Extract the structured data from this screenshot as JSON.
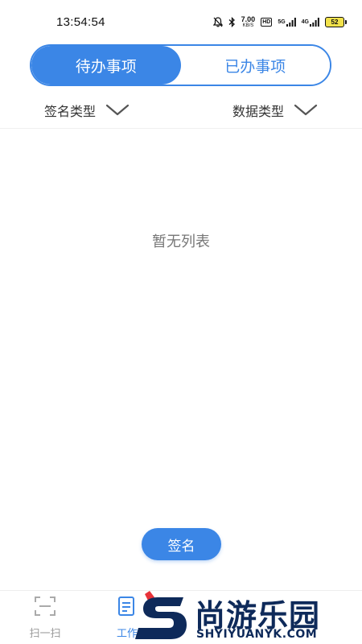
{
  "status_bar": {
    "time": "13:54:54",
    "net_speed": "7.00",
    "net_speed_unit": "KB/S",
    "hd_label": "HD",
    "signal_5g": "5G",
    "signal_4g": "4G",
    "battery": "52"
  },
  "tabs": [
    {
      "label": "待办事项",
      "active": true
    },
    {
      "label": "已办事项",
      "active": false
    }
  ],
  "filters": {
    "sign_type_label": "签名类型",
    "data_type_label": "数据类型"
  },
  "empty_state": {
    "text": "暂无列表"
  },
  "sign_button": {
    "label": "签名"
  },
  "bottom_nav": {
    "items": [
      {
        "label": "扫一扫",
        "icon": "scan-icon",
        "active": false
      },
      {
        "label": "工作",
        "icon": "work-icon",
        "active": true
      }
    ]
  },
  "watermark": {
    "brand": "尚游乐园",
    "url": "SHYIYUANYK.COM"
  },
  "colors": {
    "accent": "#3b86e6",
    "text": "#333333",
    "muted": "#999999",
    "watermark": "#0e2a5a",
    "watermark_red": "#e8333a"
  }
}
